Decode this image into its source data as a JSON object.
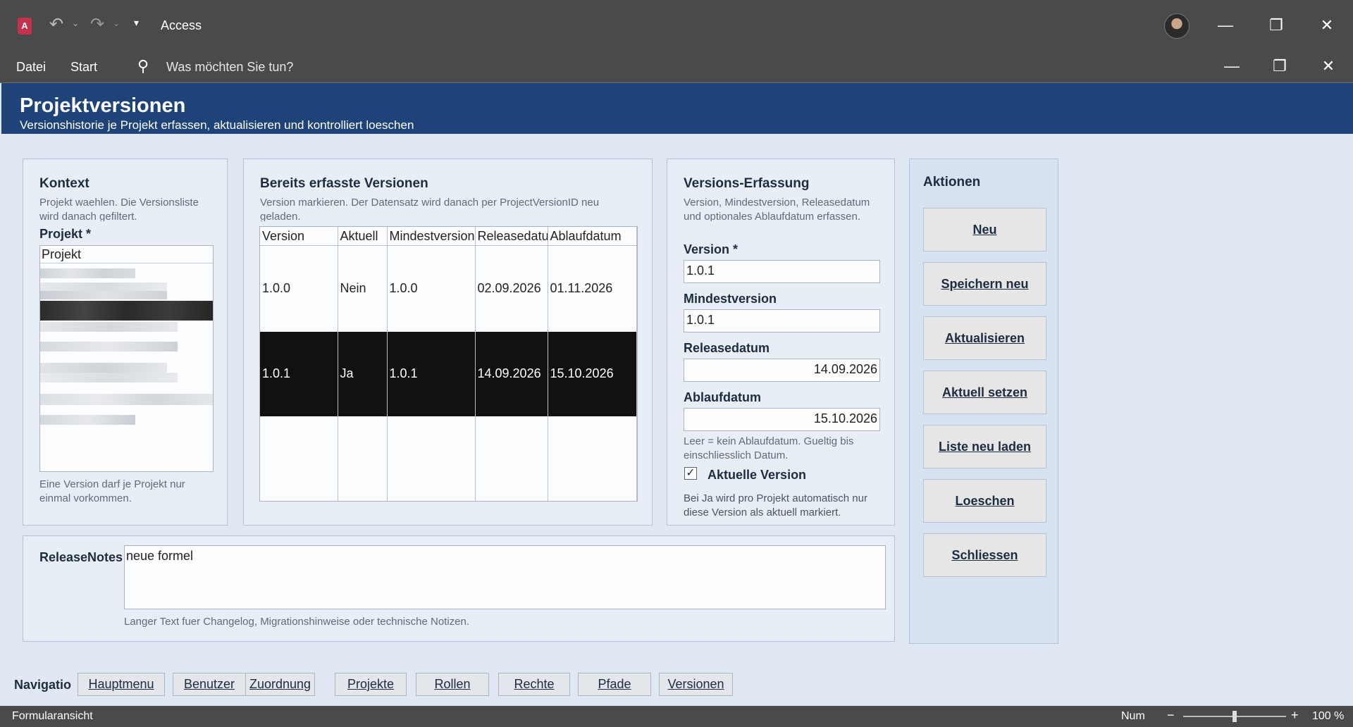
{
  "titlebar": {
    "app_title": "Access",
    "minimize": "—",
    "restore": "❐",
    "close": "✕"
  },
  "menubar": {
    "file": "Datei",
    "home": "Start",
    "tellme": "Was möchten Sie tun?"
  },
  "form": {
    "title": "Projektversionen",
    "subtitle": "Versionshistorie je Projekt erfassen, aktualisieren und kontrolliert loeschen"
  },
  "context": {
    "title": "Kontext",
    "hint": "Projekt waehlen. Die Versionsliste wird danach gefiltert.",
    "project_label": "Projekt *",
    "list_header": "Projekt",
    "footer_hint": "Eine Version darf je Projekt nur einmal vorkommen."
  },
  "versions": {
    "title": "Bereits erfasste Versionen",
    "hint": "Version markieren. Der Datensatz wird danach per ProjectVersionID neu geladen.",
    "columns": [
      "Version",
      "Aktuell",
      "Mindestversion",
      "Releasedatum",
      "Ablaufdatum"
    ],
    "rows": [
      [
        "1.0.0",
        "Nein",
        "1.0.0",
        "02.09.2026",
        "01.11.2026"
      ],
      [
        "1.0.1",
        "Ja",
        "1.0.1",
        "14.09.2026",
        "15.10.2026"
      ]
    ],
    "selected_row": 1
  },
  "entry": {
    "title": "Versions-Erfassung",
    "hint": "Version, Mindestversion, Releasedatum und optionales Ablaufdatum erfassen.",
    "version_label": "Version *",
    "version_value": "1.0.1",
    "minversion_label": "Mindestversion",
    "minversion_value": "1.0.1",
    "release_label": "Releasedatum",
    "release_value": "14.09.2026",
    "expiry_label": "Ablaufdatum",
    "expiry_value": "15.10.2026",
    "expiry_hint": "Leer = kein Ablaufdatum. Gueltig bis einschliesslich Datum.",
    "current_label": "Aktuelle Version",
    "current_checked": true,
    "current_hint": "Bei Ja wird pro Projekt automatisch nur diese Version als aktuell markiert."
  },
  "actions": {
    "title": "Aktionen",
    "buttons": [
      "Neu",
      "Speichern neu",
      "Aktualisieren",
      "Aktuell setzen",
      "Liste neu laden",
      "Loeschen",
      "Schliessen"
    ]
  },
  "notes": {
    "label": "ReleaseNotes",
    "value": "neue formel",
    "hint": "Langer Text fuer Changelog, Migrationshinweise oder technische Notizen."
  },
  "navigation": {
    "label": "Navigatio",
    "buttons": [
      "Hauptmenu",
      "Benutzer",
      "Zuordnung",
      "Projekte",
      "Rollen",
      "Rechte",
      "Pfade",
      "Versionen"
    ]
  },
  "statusbar": {
    "view": "Formularansicht",
    "num": "Num",
    "zoom": "100 %",
    "zoom_level": 0.5
  },
  "colors": {
    "header": "#1e4378",
    "chrome": "#4a4a4a",
    "background": "#dfe8f3"
  }
}
